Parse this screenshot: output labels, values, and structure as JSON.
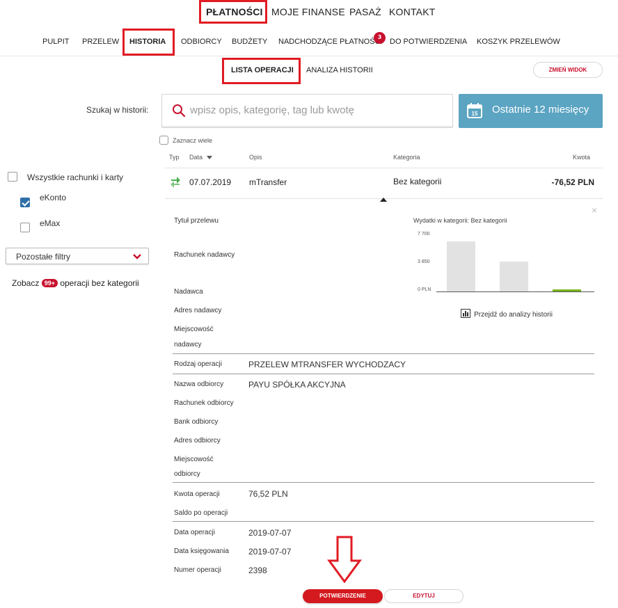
{
  "top_nav": {
    "items": [
      "PŁATNOŚCI",
      "MOJE FINANSE",
      "PASAŻ",
      "KONTAKT"
    ]
  },
  "sub_nav": {
    "items": [
      "PULPIT",
      "PRZELEW",
      "HISTORIA",
      "ODBIORCY",
      "BUDŻETY",
      "NADCHODZĄCE PŁATNOŚCI",
      "DO POTWIERDZENIA",
      "KOSZYK PRZELEWÓW"
    ],
    "badge": "3"
  },
  "view_tabs": [
    "LISTA OPERACJI",
    "ANALIZA HISTORII"
  ],
  "change_view_label": "ZMIEŃ WIDOK",
  "search": {
    "label": "Szukaj w historii:",
    "placeholder": "wpisz opis, kategorię, tag lub kwotę",
    "date_range_label": "Ostatnie 12 miesięcy",
    "calendar_day": "15"
  },
  "select_many_label": "Zaznacz wiele",
  "table": {
    "headers": {
      "type": "Typ",
      "date": "Data",
      "desc": "Opis",
      "category": "Kategoria",
      "amount": "Kwota"
    },
    "row": {
      "date": "07.07.2019",
      "desc": "mTransfer",
      "category": "Bez kategorii",
      "amount": "-76,52 PLN"
    }
  },
  "sidebar": {
    "all_accounts_label": "Wszystkie rachunki i karty",
    "accounts": [
      {
        "label": "eKonto",
        "checked": true
      },
      {
        "label": "eMax",
        "checked": false
      }
    ],
    "filters_label": "Pozostałe filtry",
    "uncategorized": {
      "prefix": "Zobacz",
      "badge": "99+",
      "suffix": "operacji bez kategorii"
    }
  },
  "details": {
    "close": "×",
    "labels": {
      "title": "Tytuł przelewu",
      "sender_account": "Rachunek nadawcy",
      "sender": "Nadawca",
      "sender_address": "Adres nadawcy",
      "sender_city_1": "Miejscowość",
      "sender_city_2": "nadawcy",
      "op_type": "Rodzaj operacji",
      "recipient_name": "Nazwa odbiorcy",
      "recipient_account": "Rachunek odbiorcy",
      "recipient_bank": "Bank odbiorcy",
      "recipient_address": "Adres odbiorcy",
      "recipient_city_1": "Miejscowość",
      "recipient_city_2": "odbiorcy",
      "amount": "Kwota operacji",
      "balance": "Saldo po operacji",
      "op_date": "Data operacji",
      "booking_date": "Data księgowania",
      "op_number": "Numer operacji"
    },
    "values": {
      "op_type": "PRZELEW MTRANSFER WYCHODZACY",
      "recipient_name": "PAYU SPÓŁKA AKCYJNA",
      "amount": "76,52 PLN",
      "op_date": "2019-07-07",
      "booking_date": "2019-07-07",
      "op_number": "2398"
    },
    "chart": {
      "title_prefix": "Wydatki w kategorii:",
      "category": "Bez kategorii",
      "y_ticks": [
        "7 700",
        "3 850",
        "0 PLN"
      ],
      "link_label": "Przejdź do analizy historii"
    }
  },
  "chart_data": {
    "type": "bar",
    "title": "Wydatki w kategorii: Bez kategorii",
    "ylim": [
      0,
      7700
    ],
    "y_ticks": [
      7700,
      3850,
      0
    ],
    "values": [
      6800,
      4000,
      280
    ],
    "colors": [
      "#e2e2e2",
      "#e2e2e2",
      "#7ab51d"
    ]
  },
  "actions": {
    "confirm": "POTWIERDZENIE",
    "edit": "EDYTUJ"
  },
  "colors": {
    "accent": "#c8102e",
    "highlight": "#e01b24",
    "date_button": "#5ba4c2",
    "checkbox": "#2f6fa7",
    "green": "#4caf50"
  }
}
